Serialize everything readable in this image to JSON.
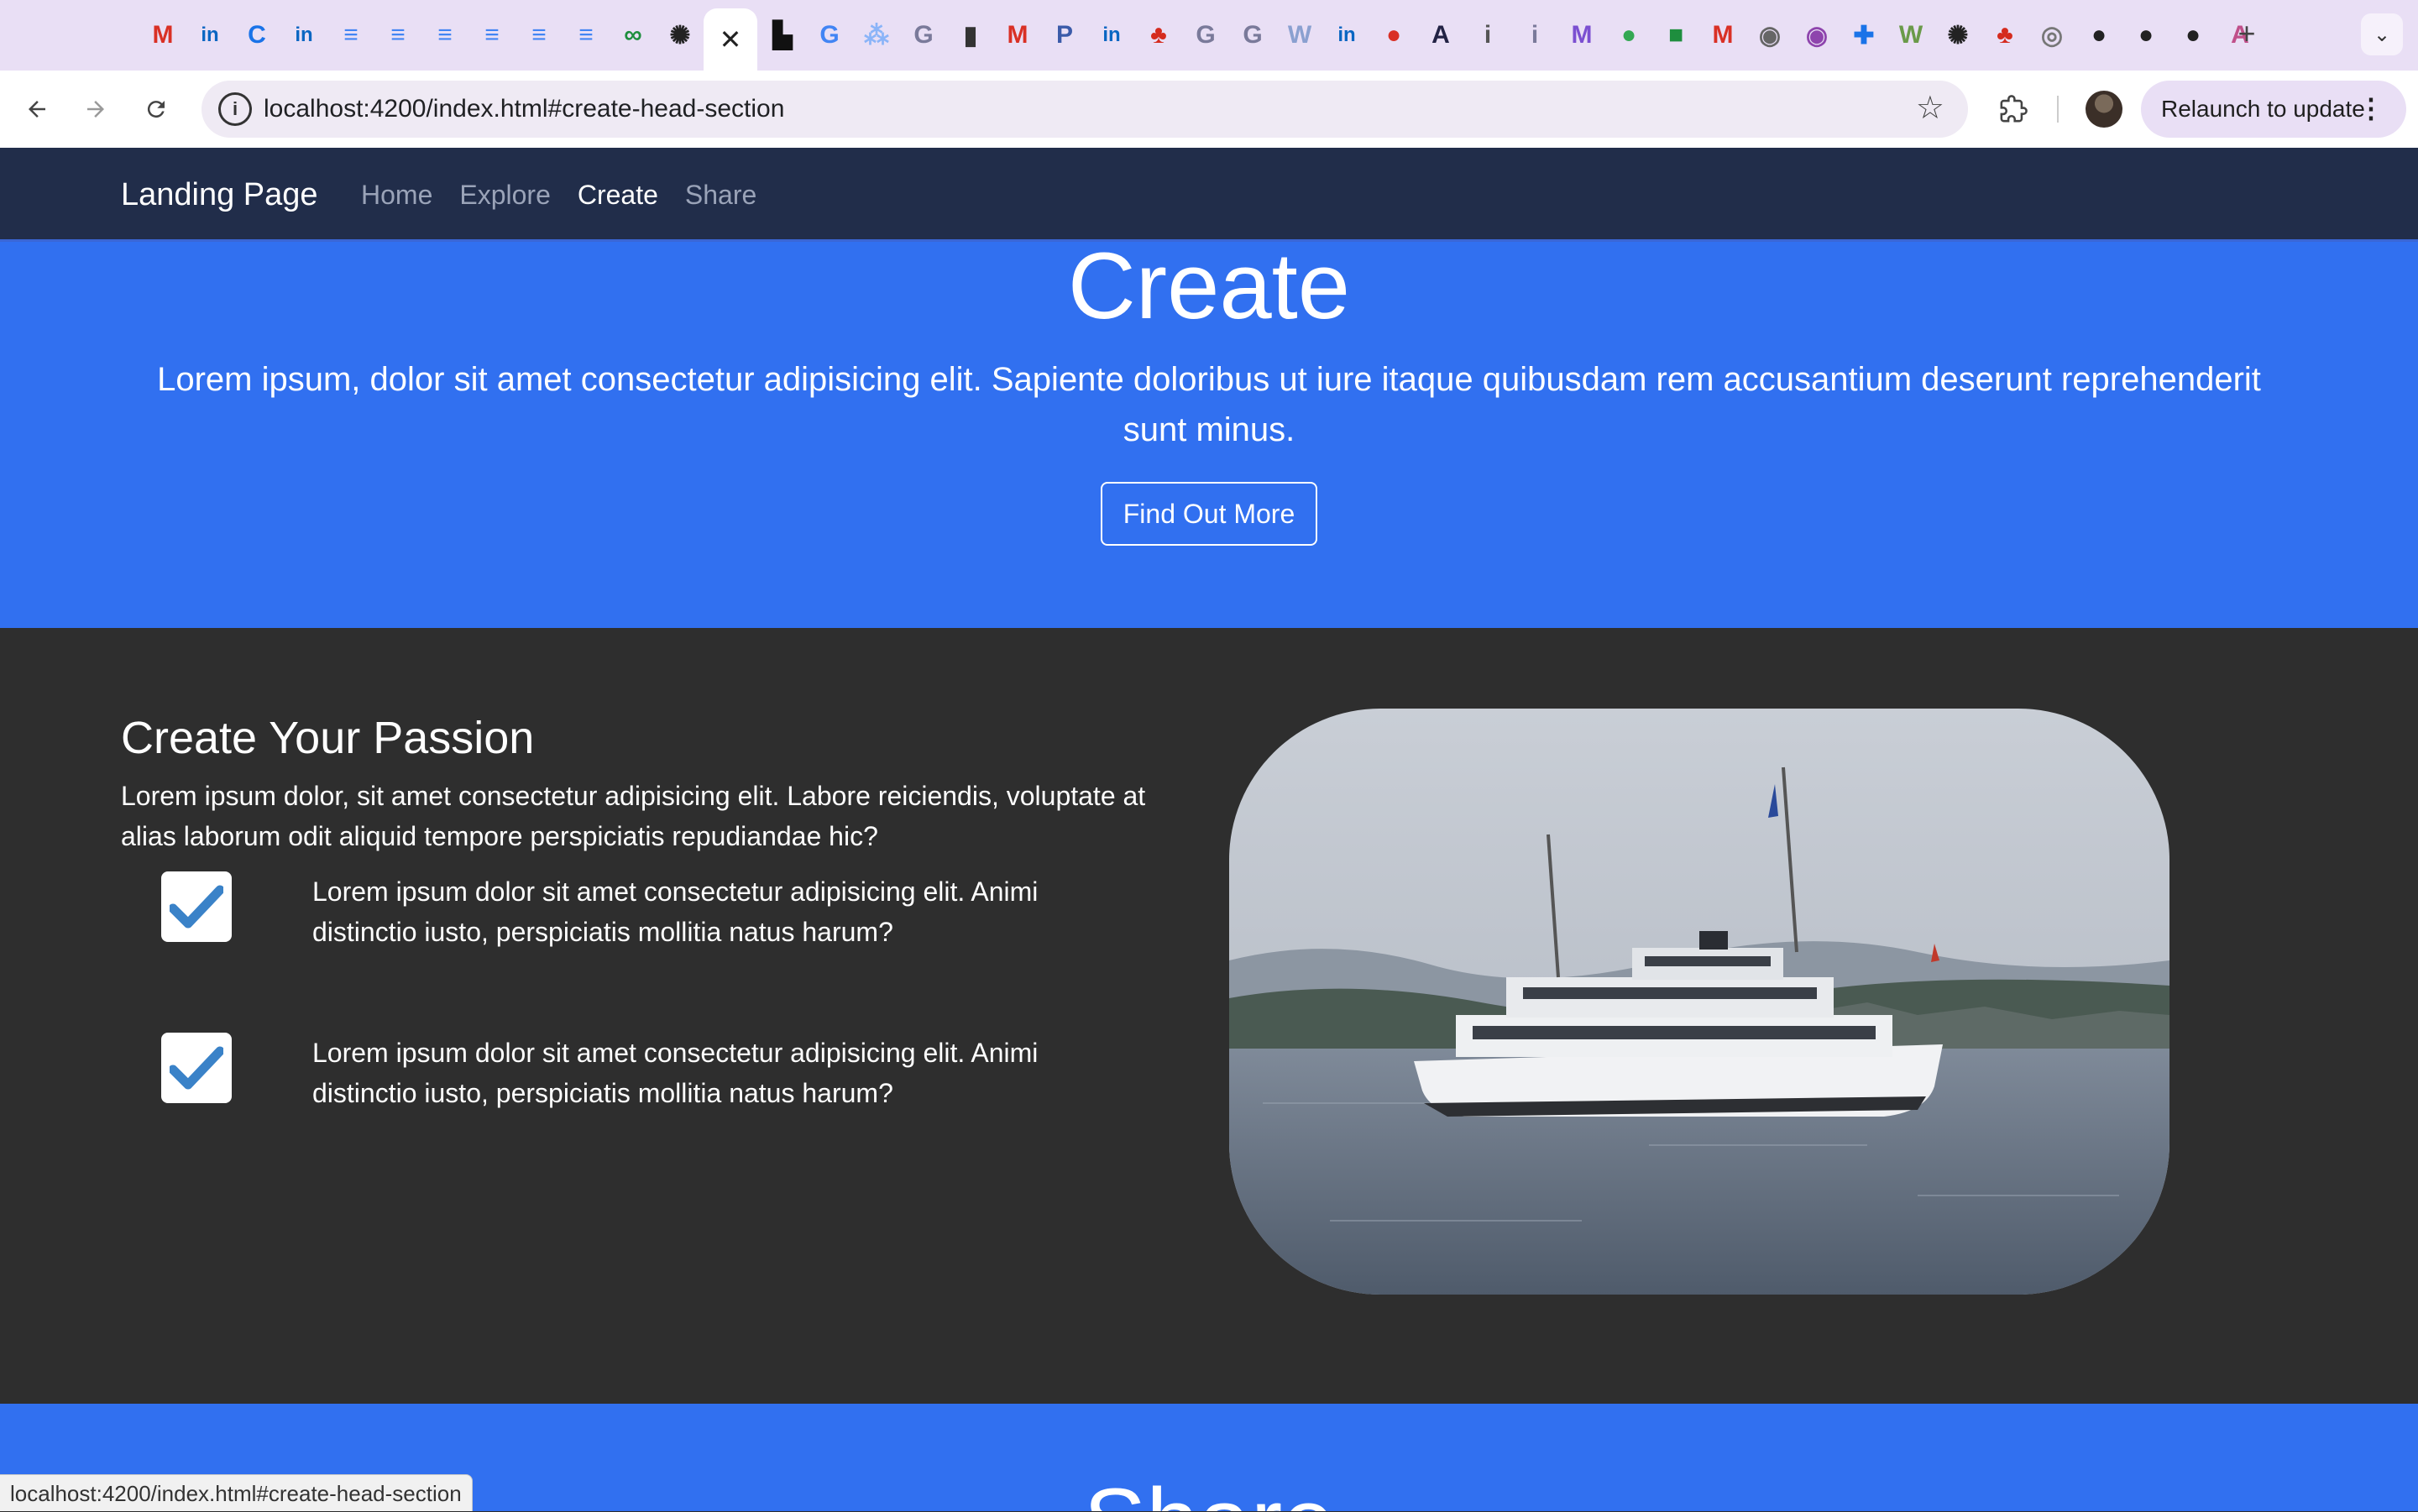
{
  "browser": {
    "tabs": [
      {
        "icon": "gmail-icon",
        "glyph": "M",
        "color": "#d93025"
      },
      {
        "icon": "linkedin-icon",
        "glyph": "in",
        "color": "#0a66c2"
      },
      {
        "icon": "c-circle-icon",
        "glyph": "C",
        "color": "#1a73e8"
      },
      {
        "icon": "linkedin-icon",
        "glyph": "in",
        "color": "#0a66c2"
      },
      {
        "icon": "google-docs-icon",
        "glyph": "≡",
        "color": "#4285f4"
      },
      {
        "icon": "google-docs-icon",
        "glyph": "≡",
        "color": "#4285f4"
      },
      {
        "icon": "google-docs-icon",
        "glyph": "≡",
        "color": "#4285f4"
      },
      {
        "icon": "google-docs-icon",
        "glyph": "≡",
        "color": "#4285f4"
      },
      {
        "icon": "google-docs-icon",
        "glyph": "≡",
        "color": "#4285f4"
      },
      {
        "icon": "google-docs-icon",
        "glyph": "≡",
        "color": "#4285f4"
      },
      {
        "icon": "ampersand-icon",
        "glyph": "∞",
        "color": "#1e8e3e"
      },
      {
        "icon": "openai-icon",
        "glyph": "✺",
        "color": "#222222"
      }
    ],
    "tabs_right": [
      {
        "icon": "unsplash-icon",
        "glyph": "▙",
        "color": "#111111"
      },
      {
        "icon": "google-icon",
        "glyph": "G",
        "color": "#4285f4"
      },
      {
        "icon": "chart-icon",
        "glyph": "⁂",
        "color": "#8ab4f8"
      },
      {
        "icon": "grammarly-icon",
        "glyph": "G",
        "color": "#7a7a9a"
      },
      {
        "icon": "book-icon",
        "glyph": "▮",
        "color": "#333333"
      },
      {
        "icon": "gmail-icon",
        "glyph": "M",
        "color": "#d93025"
      },
      {
        "icon": "p-circle-icon",
        "glyph": "P",
        "color": "#3b5ba9"
      },
      {
        "icon": "linkedin-icon",
        "glyph": "in",
        "color": "#0a66c2"
      },
      {
        "icon": "maple-leaf-icon",
        "glyph": "♣",
        "color": "#d52b1e"
      },
      {
        "icon": "grammarly-icon",
        "glyph": "G",
        "color": "#7a7a9a"
      },
      {
        "icon": "grammarly-icon",
        "glyph": "G",
        "color": "#7a7a9a"
      },
      {
        "icon": "w-circle-icon",
        "glyph": "W",
        "color": "#8aa0d0"
      },
      {
        "icon": "linkedin-icon",
        "glyph": "in",
        "color": "#0a66c2"
      },
      {
        "icon": "red-circle-icon",
        "glyph": "●",
        "color": "#d93025"
      },
      {
        "icon": "a-letter-icon",
        "glyph": "A",
        "color": "#222244"
      },
      {
        "icon": "info-icon",
        "glyph": "i",
        "color": "#555555"
      },
      {
        "icon": "info-circle-icon",
        "glyph": "i",
        "color": "#7a7a9a"
      },
      {
        "icon": "m-circle-icon",
        "glyph": "M",
        "color": "#7b4fd1"
      },
      {
        "icon": "green-circle-icon",
        "glyph": "●",
        "color": "#34a853"
      },
      {
        "icon": "green-square-icon",
        "glyph": "■",
        "color": "#1e8e3e"
      },
      {
        "icon": "gmail-icon",
        "glyph": "M",
        "color": "#d93025"
      },
      {
        "icon": "grey-circle-icon",
        "glyph": "◉",
        "color": "#666666"
      },
      {
        "icon": "purple-circle-icon",
        "glyph": "◉",
        "color": "#8e44ad"
      },
      {
        "icon": "blue-plus-icon",
        "glyph": "✚",
        "color": "#1a73e8"
      },
      {
        "icon": "w-circle-icon",
        "glyph": "W",
        "color": "#6a9a4a"
      },
      {
        "icon": "openai-icon",
        "glyph": "✺",
        "color": "#222222"
      },
      {
        "icon": "maple-leaf-icon",
        "glyph": "♣",
        "color": "#d52b1e"
      },
      {
        "icon": "seal-icon",
        "glyph": "◎",
        "color": "#777777"
      },
      {
        "icon": "github-icon",
        "glyph": "●",
        "color": "#222222"
      },
      {
        "icon": "github-icon",
        "glyph": "●",
        "color": "#222222"
      },
      {
        "icon": "github-icon",
        "glyph": "●",
        "color": "#222222"
      },
      {
        "icon": "a-triangle-icon",
        "glyph": "A",
        "color": "#c0508a"
      }
    ],
    "active_tab_close": "✕",
    "new_tab_glyph": "+",
    "tab_menu_glyph": "⌄",
    "url": "localhost:4200/index.html#create-head-section",
    "relaunch_label": "Relaunch to update",
    "status_url": "localhost:4200/index.html#create-head-section"
  },
  "site": {
    "brand": "Landing Page",
    "nav": [
      {
        "label": "Home",
        "active": false
      },
      {
        "label": "Explore",
        "active": false
      },
      {
        "label": "Create",
        "active": true
      },
      {
        "label": "Share",
        "active": false
      }
    ],
    "hero": {
      "title": "Create",
      "text": "Lorem ipsum, dolor sit amet consectetur adipisicing elit. Sapiente doloribus ut iure itaque quibusdam rem accusantium deserunt reprehenderit sunt minus.",
      "button": "Find Out More"
    },
    "passion": {
      "title": "Create Your Passion",
      "text": "Lorem ipsum dolor, sit amet consectetur adipisicing elit. Labore reiciendis, voluptate at alias laborum odit aliquid tempore perspiciatis repudiandae hic?",
      "features": [
        "Lorem ipsum dolor sit amet consectetur adipisicing elit. Animi distinctio iusto, perspiciatis mollitia natus harum?",
        "Lorem ipsum dolor sit amet consectetur adipisicing elit. Animi distinctio iusto, perspiciatis mollitia natus harum?"
      ],
      "image_alt": "ferry-boat-on-lake"
    },
    "next_section_title": "Share"
  },
  "colors": {
    "nav_bg": "#212d4a",
    "hero_bg": "#3170f0",
    "section_dark": "#2e2e2e",
    "check_blue": "#3a82c8"
  }
}
